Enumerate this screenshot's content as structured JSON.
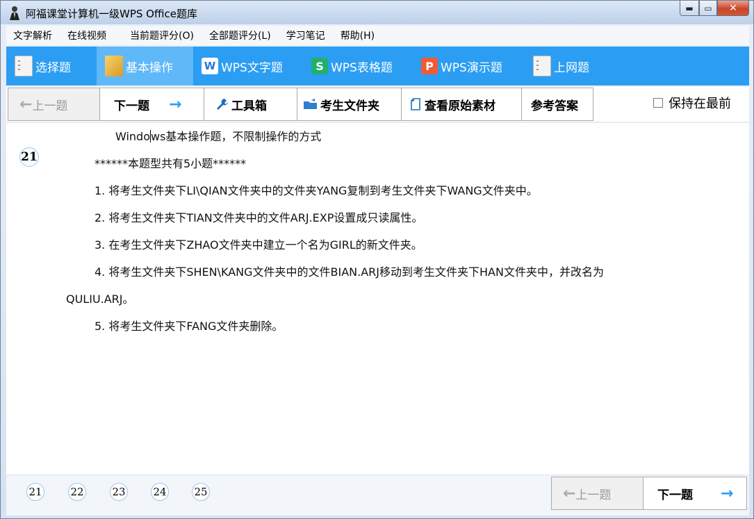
{
  "window": {
    "title": "阿福课堂计算机一级WPS Office题库",
    "icon": "person-icon",
    "controls": {
      "minimize": "▬",
      "maximize": "▭",
      "close": "✕"
    }
  },
  "menu": {
    "items": [
      "文字解析",
      "在线视频",
      "当前题评分(O)",
      "全部题评分(L)",
      "学习笔记",
      "帮助(H)"
    ]
  },
  "categories": [
    {
      "label": "选择题",
      "icon": "document-icon"
    },
    {
      "label": "基本操作",
      "icon": "folder-icon",
      "active": true
    },
    {
      "label": "WPS文字题",
      "icon": "wps-writer-icon",
      "glyph": "W"
    },
    {
      "label": "WPS表格题",
      "icon": "wps-spreadsheet-icon",
      "glyph": "S"
    },
    {
      "label": "WPS演示题",
      "icon": "wps-presentation-icon",
      "glyph": "P"
    },
    {
      "label": "上网题",
      "icon": "document-icon"
    }
  ],
  "toolbar": {
    "prev_label": "上一题",
    "next_label": "下一题",
    "toolbox_label": "工具箱",
    "student_folder_label": "考生文件夹",
    "view_original_label": "查看原始素材",
    "answer_label": "参考答案",
    "keep_on_top_label": "保持在最前",
    "keep_on_top_checked": false
  },
  "question": {
    "number": "21",
    "heading_before_caret": "Windo",
    "heading_after_caret": "ws基本操作题，不限制操作的方式",
    "count_line": "******本题型共有5小题******",
    "items": [
      "1. 将考生文件夹下LI\\QIAN文件夹中的文件夹YANG复制到考生文件夹下WANG文件夹中。",
      "2. 将考生文件夹下TIAN文件夹中的文件ARJ.EXP设置成只读属性。",
      "3. 在考生文件夹下ZHAO文件夹中建立一个名为GIRL的新文件夹。",
      "4. 将考生文件夹下SHEN\\KANG文件夹中的文件BIAN.ARJ移动到考生文件夹下HAN文件夹中，并改名为",
      "QULIU.ARJ。",
      "5. 将考生文件夹下FANG文件夹删除。"
    ]
  },
  "pager": {
    "numbers": [
      "21",
      "22",
      "23",
      "24",
      "25"
    ],
    "prev_label": "上一题",
    "next_label": "下一题"
  }
}
